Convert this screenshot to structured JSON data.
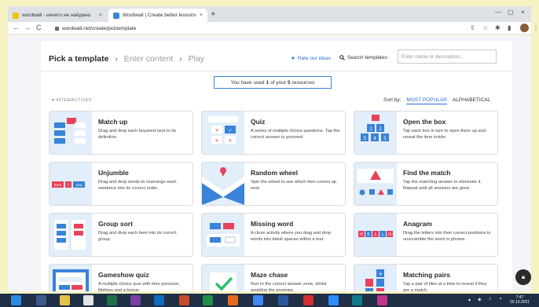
{
  "browser": {
    "tabs": [
      {
        "title": "wordwall - ничего не найдено",
        "close": "×",
        "favicon_color": "#f4c20d"
      },
      {
        "title": "Wordwall | Create better lessons",
        "close": "×",
        "favicon_color": "#3a83d6"
      }
    ],
    "new_tab": "+",
    "window_controls": [
      "—",
      "▢",
      "×"
    ],
    "nav": [
      "←",
      "→",
      "C"
    ],
    "url": "wordwall.net/create/picktemplate"
  },
  "header": {
    "steps": [
      "Pick a template",
      "Enter content",
      "Play"
    ],
    "step_arrows": [
      "›",
      "›"
    ],
    "rate_ideas": "Rate our ideas",
    "search_label": "Search templates:",
    "search_placeholder": "Enter name or description..."
  },
  "resources": {
    "prefix": "You have used",
    "used": "1",
    "mid": "of your",
    "total": "5",
    "suffix": "resources"
  },
  "section_label": "INTERACTIVES",
  "sort": {
    "label": "Sort by:",
    "options": [
      "MOST POPULAR",
      "ALPHABETICAL"
    ],
    "selected": "MOST POPULAR"
  },
  "templates": [
    {
      "title": "Match up",
      "desc": "Drag and drop each keyword next to its definition."
    },
    {
      "title": "Quiz",
      "desc": "A series of multiple choice questions. Tap the correct answer to proceed."
    },
    {
      "title": "Open the box",
      "desc": "Tap each box in turn to open them up and reveal the item inside."
    },
    {
      "title": "Unjumble",
      "desc": "Drag and drop words to rearrange each sentence into its correct order."
    },
    {
      "title": "Random wheel",
      "desc": "Spin the wheel to see which item comes up next."
    },
    {
      "title": "Find the match",
      "desc": "Tap the matching answer to eliminate it. Repeat until all answers are gone."
    },
    {
      "title": "Group sort",
      "desc": "Drag and drop each item into its correct group."
    },
    {
      "title": "Missing word",
      "desc": "A cloze activity where you drag and drop words into blank spaces within a text."
    },
    {
      "title": "Anagram",
      "desc": "Drag the letters into their correct positions to unscramble the word or phrase."
    },
    {
      "title": "Gameshow quiz",
      "desc": "A multiple choice quiz with time pressure, lifelines and a bonus"
    },
    {
      "title": "Maze chase",
      "desc": "Run to the correct answer zone, whilst avoiding the enemies."
    },
    {
      "title": "Matching pairs",
      "desc": "Tap a pair of tiles at a time to reveal if they are a match."
    }
  ],
  "thumb_text": {
    "box_numbers": [
      "1",
      "2",
      "3",
      "4",
      "5"
    ],
    "unjumble_words": [
      "love",
      "I",
      "you"
    ],
    "anagram_letters": [
      "H",
      "E",
      "L",
      "L",
      "O"
    ]
  },
  "taskbar": {
    "clock_time": "7:47",
    "clock_date": "20.10.2021"
  },
  "colors": {
    "accent": "#2c6ed5",
    "tile_thumb": "#e2eef9",
    "red": "#e8425b",
    "blue": "#3a83d6"
  }
}
